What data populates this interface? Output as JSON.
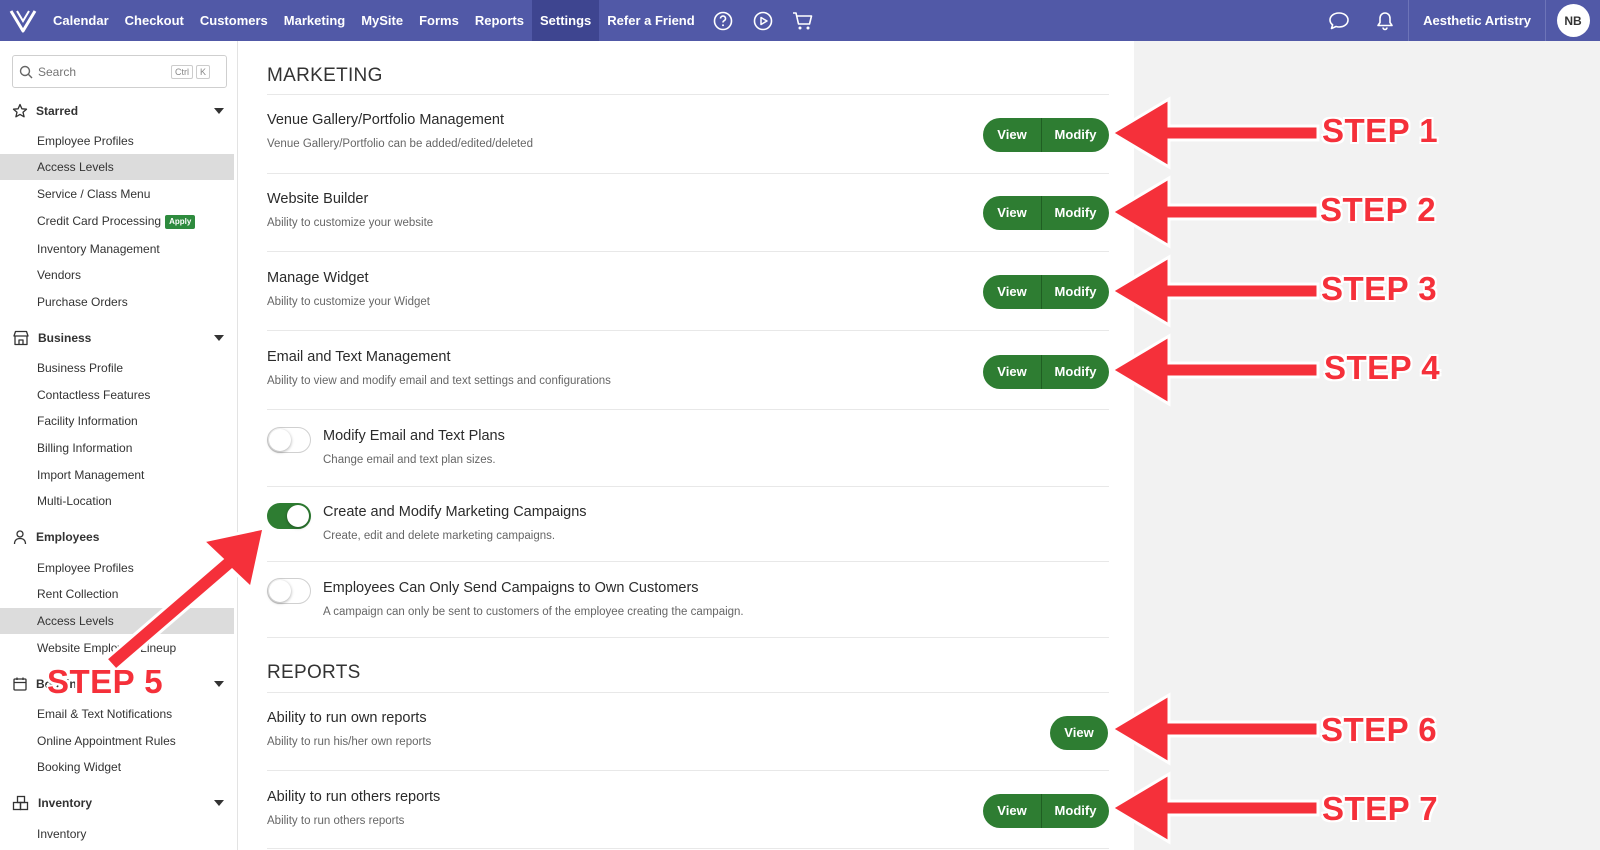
{
  "nav": {
    "items": [
      "Calendar",
      "Checkout",
      "Customers",
      "Marketing",
      "MySite",
      "Forms",
      "Reports",
      "Settings",
      "Refer a Friend"
    ],
    "active": "Settings",
    "business_name": "Aesthetic Artistry",
    "avatar_initials": "NB",
    "colors": {
      "bar": "#5159a7",
      "active": "#3e4590"
    }
  },
  "sidebar": {
    "search_placeholder": "Search",
    "shortcut_ctrl": "Ctrl",
    "shortcut_k": "K",
    "sections": [
      {
        "label": "Starred",
        "icon": "star-icon",
        "items": [
          "Employee Profiles",
          "Access Levels",
          "Service / Class Menu",
          "Credit Card Processing",
          "Inventory Management",
          "Vendors",
          "Purchase Orders"
        ]
      },
      {
        "label": "Business",
        "icon": "storefront-icon",
        "items": [
          "Business Profile",
          "Contactless Features",
          "Facility Information",
          "Billing Information",
          "Import Management",
          "Multi-Location"
        ]
      },
      {
        "label": "Employees",
        "icon": "person-icon",
        "items": [
          "Employee Profiles",
          "Rent Collection",
          "Access Levels",
          "Website Employee Lineup"
        ]
      },
      {
        "label": "Booking",
        "icon": "calendar-icon",
        "items": [
          "Email & Text Notifications",
          "Online Appointment Rules",
          "Booking Widget"
        ]
      },
      {
        "label": "Inventory",
        "icon": "boxes-icon",
        "items": [
          "Inventory"
        ]
      }
    ],
    "apply_badge": "Apply"
  },
  "marketing": {
    "title": "MARKETING",
    "rows": [
      {
        "title": "Venue Gallery/Portfolio Management",
        "desc": "Venue Gallery/Portfolio can be added/edited/deleted",
        "view": "View",
        "modify": "Modify"
      },
      {
        "title": "Website Builder",
        "desc": "Ability to customize your website",
        "view": "View",
        "modify": "Modify"
      },
      {
        "title": "Manage Widget",
        "desc": "Ability to customize your Widget",
        "view": "View",
        "modify": "Modify"
      },
      {
        "title": "Email and Text Management",
        "desc": "Ability to view and modify email and text settings and configurations",
        "view": "View",
        "modify": "Modify"
      }
    ],
    "toggles": [
      {
        "title": "Modify Email and Text Plans",
        "desc": "Change email and text plan sizes.",
        "on": false
      },
      {
        "title": "Create and Modify Marketing Campaigns",
        "desc": "Create, edit and delete marketing campaigns.",
        "on": true
      },
      {
        "title": "Employees Can Only Send Campaigns to Own Customers",
        "desc": "A campaign can only be sent to customers of the employee creating the campaign.",
        "on": false
      }
    ]
  },
  "reports": {
    "title": "REPORTS",
    "rows": [
      {
        "title": "Ability to run own reports",
        "desc": "Ability to run his/her own reports",
        "view": "View"
      },
      {
        "title": "Ability to run others reports",
        "desc": "Ability to run others reports",
        "view": "View",
        "modify": "Modify"
      }
    ]
  },
  "annotations": {
    "steps": [
      "STEP 1",
      "STEP 2",
      "STEP 3",
      "STEP 4",
      "STEP 5",
      "STEP 6",
      "STEP 7"
    ],
    "color": "#f5303a"
  },
  "colors": {
    "button": "#2e7d32",
    "toggle_on": "#2e7d32",
    "right_pane": "#f2f2f2"
  }
}
